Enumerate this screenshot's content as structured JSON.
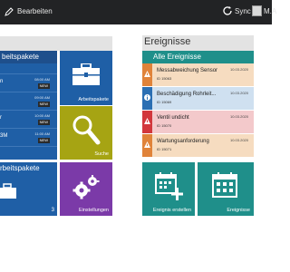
{
  "topbar": {
    "edit_label": "Bearbeiten",
    "sync_label": "Sync",
    "user_label": "M.A"
  },
  "left": {
    "list_title": "beitspakete",
    "rows": [
      {
        "title": "",
        "time": "",
        "badge": ""
      },
      {
        "title": "n",
        "time": "08:00 AM",
        "badge": "NEW"
      },
      {
        "title": "",
        "time": "09:00 AM",
        "badge": "NEW"
      },
      {
        "title": "r",
        "time": "10:00 AM",
        "badge": "NEW"
      },
      {
        "title": "3M",
        "time": "11:00 AM",
        "badge": "NEW"
      }
    ],
    "arbeitspakete_label": "Arbeitspakete",
    "suche_label": "Suche",
    "bottom_title": "rbeitspakete",
    "bottom_count": "3",
    "einstellungen_label": "Einstellungen"
  },
  "right": {
    "title": "Ereignisse",
    "list_title": "Alle Ereignisse",
    "events": [
      {
        "title": "Messabweichung Sensor",
        "id": "ID 15063",
        "date": "10.03.2020",
        "bg": "#f6dcc0",
        "icon_bg": "#e0833a",
        "icon": "warning-icon"
      },
      {
        "title": "Beschädigung Rohrleit...",
        "id": "ID 15069",
        "date": "10.03.2020",
        "bg": "#cfe0f0",
        "icon_bg": "#2b6fb3",
        "icon": "info-icon"
      },
      {
        "title": "Ventil undicht",
        "id": "ID 15070",
        "date": "10.03.2020",
        "bg": "#f3c9cb",
        "icon_bg": "#d2373c",
        "icon": "warning-icon"
      },
      {
        "title": "Wartungsanforderung",
        "id": "ID 15071",
        "date": "10.03.2020",
        "bg": "#f6dcc0",
        "icon_bg": "#e0833a",
        "icon": "warning-icon"
      }
    ],
    "erstellen_label": "Ereignis erstellen",
    "ereignisse_label": "Ereignisse"
  }
}
